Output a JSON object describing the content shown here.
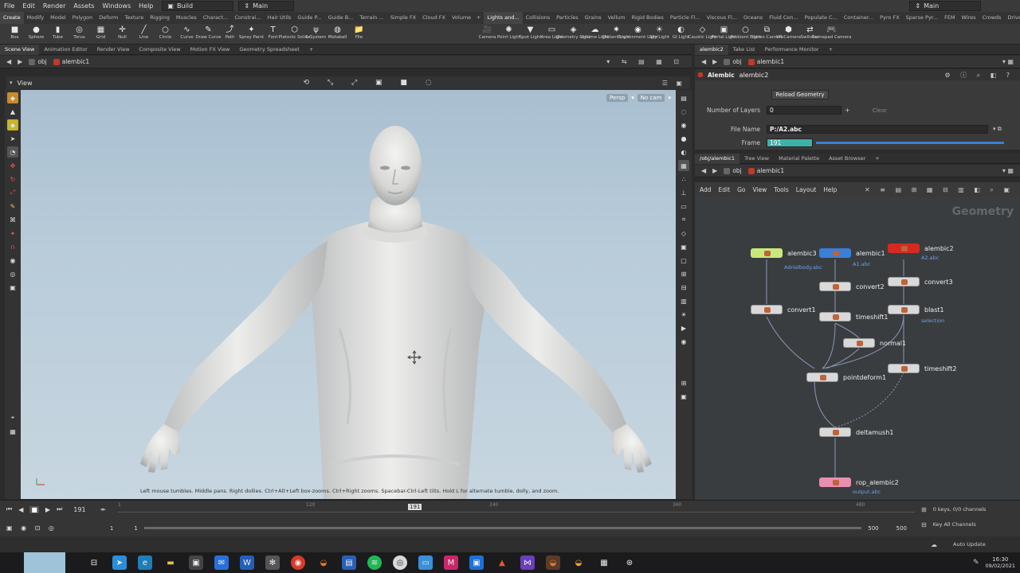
{
  "menu": {
    "items": [
      "File",
      "Edit",
      "Render",
      "Assets",
      "Windows",
      "Help"
    ],
    "desktop": "Build",
    "main": "Main",
    "right_main": "Main"
  },
  "shelf": {
    "tabs_left": [
      "Create",
      "Modify",
      "Model",
      "Polygon",
      "Deform",
      "Texture",
      "Rigging",
      "Muscles",
      "Charact...",
      "Constrai...",
      "Hair Utils",
      "Guide P...",
      "Guide B...",
      "Terrain ...",
      "Simple FX",
      "Cloud FX",
      "Volume"
    ],
    "tabs_right": [
      "Lights and...",
      "Collisions",
      "Particles",
      "Grains",
      "Vellum",
      "Rigid Bodies",
      "Particle Fl...",
      "Viscous Fl...",
      "Oceans",
      "Fluid Con...",
      "Populate C...",
      "Container...",
      "Pyro FX",
      "Sparse Pyr...",
      "FEM",
      "Wires",
      "Crowds",
      "Drive Sim..."
    ],
    "tools_left": [
      {
        "icon": "■",
        "label": "Box"
      },
      {
        "icon": "●",
        "label": "Sphere"
      },
      {
        "icon": "▮",
        "label": "Tube"
      },
      {
        "icon": "◎",
        "label": "Torus"
      },
      {
        "icon": "▦",
        "label": "Grid"
      },
      {
        "icon": "✛",
        "label": "Null"
      },
      {
        "icon": "╱",
        "label": "Line"
      },
      {
        "icon": "○",
        "label": "Circle"
      },
      {
        "icon": "∿",
        "label": "Curve"
      },
      {
        "icon": "✎",
        "label": "Draw Curve"
      },
      {
        "icon": "⤴",
        "label": "Path"
      },
      {
        "icon": "✦",
        "label": "Spray Paint"
      },
      {
        "icon": "T",
        "label": "Font"
      },
      {
        "icon": "⬡",
        "label": "Platonic Solids"
      },
      {
        "icon": "ψ",
        "label": "L-System"
      },
      {
        "icon": "◍",
        "label": "Metaball"
      },
      {
        "icon": "📁",
        "label": "File"
      }
    ],
    "tools_right": [
      {
        "icon": "🎥",
        "label": "Camera"
      },
      {
        "icon": "✺",
        "label": "Point Light"
      },
      {
        "icon": "▼",
        "label": "Spot Light"
      },
      {
        "icon": "▭",
        "label": "Area Light"
      },
      {
        "icon": "◈",
        "label": "Geometry Light"
      },
      {
        "icon": "☁",
        "label": "Volume Light"
      },
      {
        "icon": "✷",
        "label": "Distant Light"
      },
      {
        "icon": "◉",
        "label": "Environment Light"
      },
      {
        "icon": "☀",
        "label": "Sky Light"
      },
      {
        "icon": "◐",
        "label": "GI Light"
      },
      {
        "icon": "◇",
        "label": "Caustic Light"
      },
      {
        "icon": "▣",
        "label": "Portal Light"
      },
      {
        "icon": "○",
        "label": "Ambient Light"
      },
      {
        "icon": "⧉",
        "label": "Stereo Camera"
      },
      {
        "icon": "⬢",
        "label": "VR Camera"
      },
      {
        "icon": "⇄",
        "label": "Switcher"
      },
      {
        "icon": "🎮",
        "label": "Gamepad Camera"
      }
    ]
  },
  "left_pane": {
    "tabs": [
      "Scene View",
      "Animation Editor",
      "Render View",
      "Composite View",
      "Motion FX View",
      "Geometry Spreadsheet"
    ],
    "path": [
      "obj",
      "alembic1"
    ],
    "view_label": "View",
    "persp": "Persp",
    "cam": "No cam",
    "hint": "Left mouse tumbles. Middle pans. Right dollies. Ctrl+Alt+Left box-zooms. Ctrl+Right zooms. Spacebar-Ctrl-Left tilts. Hold L for alternate tumble, dolly, and zoom."
  },
  "param_pane": {
    "tabs": [
      "alembic2",
      "Take List",
      "Performance Monitor"
    ],
    "path": [
      "obj",
      "alembic1"
    ],
    "node_type": "Alembic",
    "node_name": "alembic2",
    "reload_label": "Reload Geometry",
    "layers_label": "Number of Layers",
    "layers_value": "0",
    "clear_label": "Clear",
    "file_label": "File Name",
    "file_value": "P:/A2.abc",
    "frame_label": "Frame",
    "frame_value": "191"
  },
  "network_pane": {
    "tabs": [
      "/obj/alembic1",
      "Tree View",
      "Material Palette",
      "Asset Browser"
    ],
    "path": [
      "obj",
      "alembic1"
    ],
    "menu": [
      "Add",
      "Edit",
      "Go",
      "View",
      "Tools",
      "Layout",
      "Help"
    ],
    "context_label": "Geometry",
    "nodes": [
      {
        "name": "alembic3",
        "sub": "Adrielbody.abc"
      },
      {
        "name": "alembic1",
        "sub": "A1.abc"
      },
      {
        "name": "alembic2",
        "sub": "A2.abc"
      },
      {
        "name": "convert2",
        "sub": ""
      },
      {
        "name": "convert3",
        "sub": ""
      },
      {
        "name": "convert1",
        "sub": ""
      },
      {
        "name": "timeshift1",
        "sub": ""
      },
      {
        "name": "blast1",
        "sub": "selection"
      },
      {
        "name": "normal1",
        "sub": ""
      },
      {
        "name": "timeshift2",
        "sub": ""
      },
      {
        "name": "pointdeform1",
        "sub": ""
      },
      {
        "name": "deltamush1",
        "sub": ""
      },
      {
        "name": "rop_alembic2",
        "sub": "output.abc"
      }
    ]
  },
  "timeline": {
    "current_frame": "191",
    "marker": "191",
    "ticks": [
      "1",
      "120",
      "240",
      "360",
      "480"
    ],
    "start": "1",
    "start2": "1",
    "end": "500",
    "end2": "500",
    "keys_info": "0 keys, 0/0 channels",
    "key_all": "Key All Channels",
    "auto_update": "Auto Update"
  },
  "taskbar": {
    "time": "16:30",
    "date": "09/02/2021"
  },
  "colors": {
    "accent_red": "#d42a22",
    "accent_blue": "#3a7fd8",
    "accent_green": "#c9e87a",
    "rop_pink": "#e88fb0",
    "frame_teal": "#3fb0a8"
  }
}
